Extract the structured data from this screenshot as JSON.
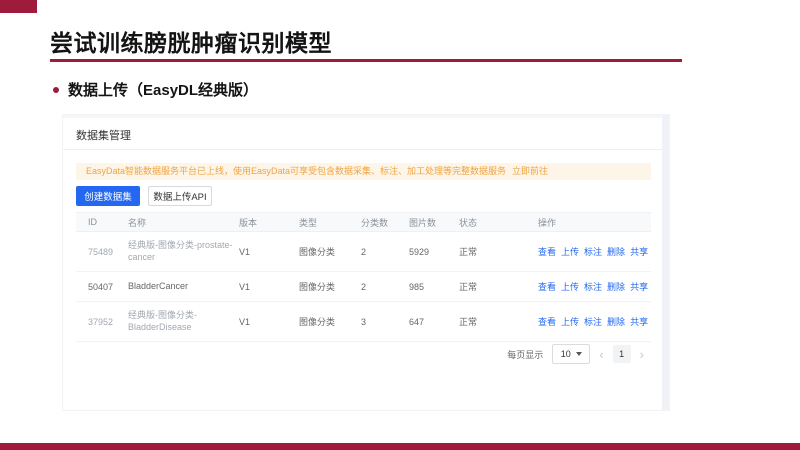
{
  "colors": {
    "accent": "#9e1b3b",
    "primary_blue": "#2468f2",
    "link_blue": "#2468f2",
    "notice_bg": "#fdf5e8",
    "notice_text": "#f0a440"
  },
  "slide": {
    "title": "尝试训练膀胱肿瘤识别模型",
    "bullet": "数据上传（EasyDL经典版）"
  },
  "console": {
    "page_title": "数据集管理",
    "notice": {
      "text": "EasyData智能数据服务平台已上线，使用EasyData可享受包含数据采集、标注、加工处理等完整数据服务",
      "link": "立即前往"
    },
    "buttons": {
      "create": "创建数据集",
      "upload_api": "数据上传API"
    },
    "table": {
      "headers": [
        "ID",
        "名称",
        "版本",
        "类型",
        "分类数",
        "图片数",
        "状态",
        "操作"
      ],
      "actions": [
        "查看",
        "上传",
        "标注",
        "删除",
        "共享"
      ],
      "rows": [
        {
          "id": "75489",
          "name_line1": "经典版-图像分类-prostate-",
          "name_line2": "cancer",
          "version": "V1",
          "type": "图像分类",
          "classes": "2",
          "images": "5929",
          "status": "正常"
        },
        {
          "id": "50407",
          "name_line1": "BladderCancer",
          "name_line2": "",
          "version": "V1",
          "type": "图像分类",
          "classes": "2",
          "images": "985",
          "status": "正常"
        },
        {
          "id": "37952",
          "name_line1": "经典版-图像分类-",
          "name_line2": "BladderDisease",
          "version": "V1",
          "type": "图像分类",
          "classes": "3",
          "images": "647",
          "status": "正常"
        }
      ]
    },
    "pagination": {
      "label": "每页显示",
      "page_size": "10",
      "prev": "‹",
      "current_page": "1",
      "next": "›"
    }
  }
}
